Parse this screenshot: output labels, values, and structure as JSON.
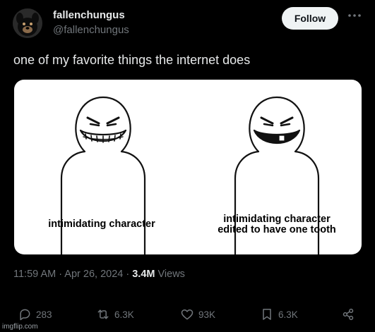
{
  "author": {
    "display_name": "fallenchungus",
    "handle": "@fallenchungus",
    "avatar_icon": "dog-avatar"
  },
  "follow_label": "Follow",
  "more_icon": "ellipsis-icon",
  "tweet_text": "one of my favorite things the internet does",
  "media": {
    "left_caption": "intimidating character",
    "right_caption_line1": "intimidating character",
    "right_caption_line2": "edited to have one tooth"
  },
  "meta": {
    "time": "11:59 AM",
    "date": "Apr 26, 2024",
    "views_count": "3.4M",
    "views_label": "Views",
    "separator": " · "
  },
  "actions": {
    "replies": "283",
    "reposts": "6.3K",
    "likes": "93K",
    "bookmarks": "6.3K"
  },
  "watermark": "imgflip.com",
  "colors": {
    "background": "#000000",
    "primary_text": "#e7e9ea",
    "secondary_text": "#71767b",
    "follow_bg": "#eff3f4"
  }
}
